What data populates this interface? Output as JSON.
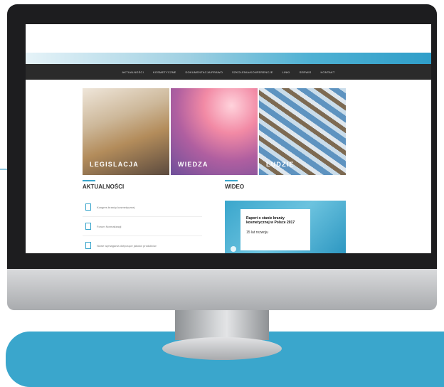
{
  "site": {
    "nav": [
      "AKTUALNOŚCI",
      "KOSMETYCZNE",
      "DOKUMENTACJA/PRAWO",
      "SZKOLENIA/KONFERENCJE",
      "LINKI",
      "SERWIS",
      "KONTAKT"
    ],
    "tiles": [
      {
        "label": "LEGISLACJA"
      },
      {
        "label": "WIEDZA"
      },
      {
        "label": "LUDZIE"
      }
    ],
    "news": {
      "title": "AKTUALNOŚCI",
      "items": [
        "Kongres branży kosmetycznej",
        "Forum Normalizacji",
        "Nowe wymagania dotyczące jakości produktów"
      ]
    },
    "video": {
      "title": "WIDEO",
      "card_title": "Raport o stanie branży kosmetycznej w Polsce 2017",
      "card_sub": "15 lat rozwoju"
    }
  },
  "colors": {
    "accent": "#3aa6cc",
    "nav_bg": "#2b2b2b",
    "monitor": "#1d1d1f"
  }
}
